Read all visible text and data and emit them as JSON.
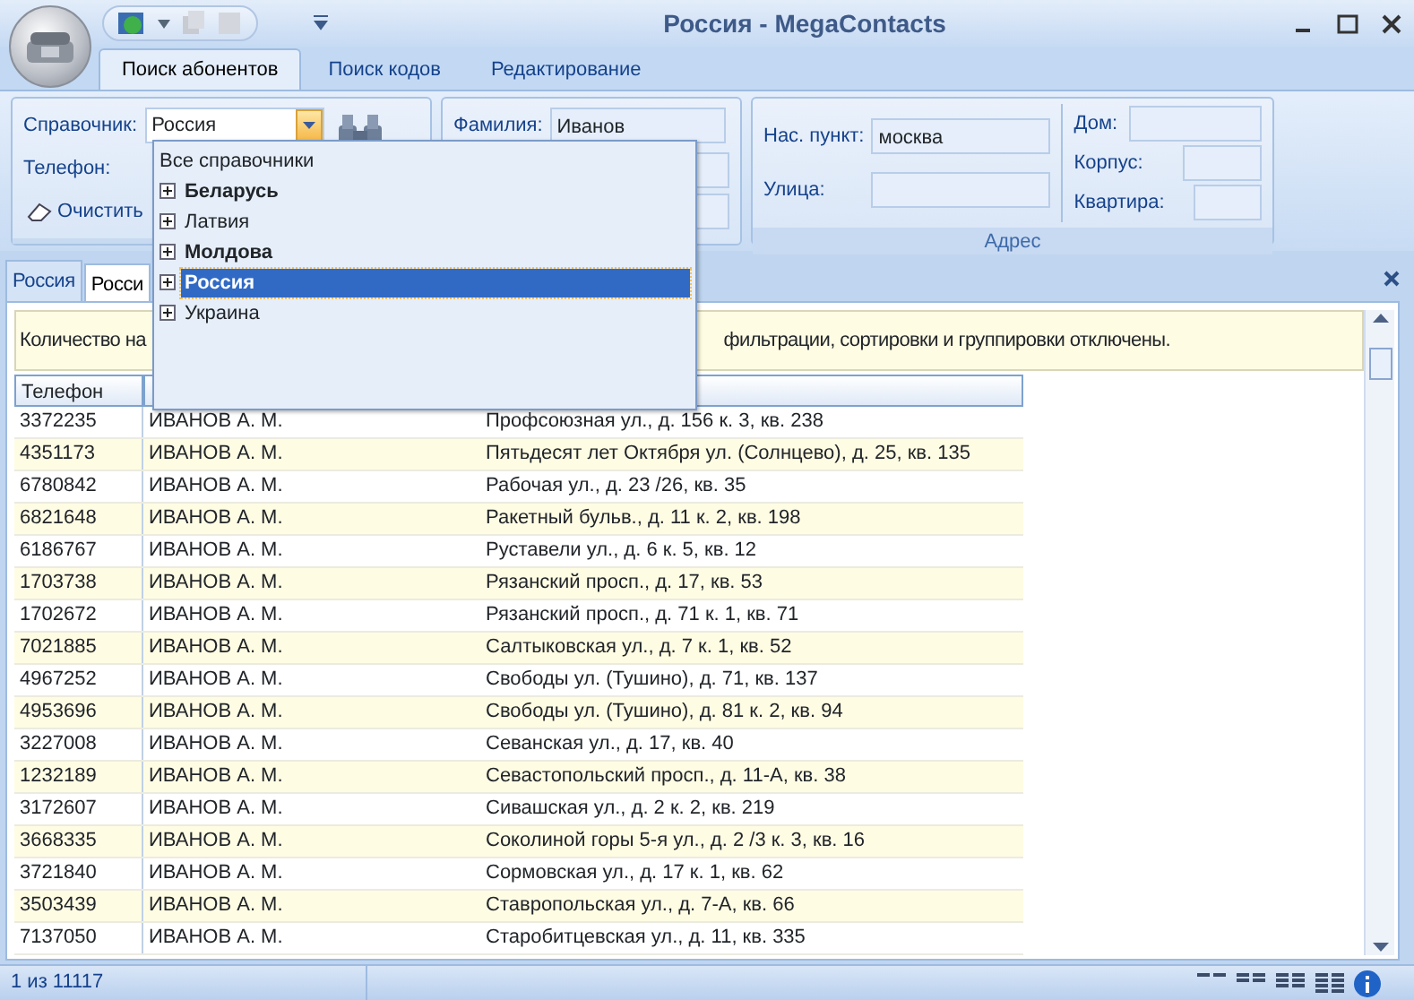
{
  "window": {
    "title": "Россия - MegaContacts"
  },
  "ribbon_tabs": [
    {
      "label": "Поиск абонентов",
      "selected": true
    },
    {
      "label": "Поиск кодов",
      "selected": false
    },
    {
      "label": "Редактирование",
      "selected": false
    }
  ],
  "search_group": {
    "directory_label": "Справочник:",
    "directory_value": "Россия",
    "phone_label": "Телефон:",
    "clear_button": "Очистить"
  },
  "name_group": {
    "surname_label": "Фамилия:",
    "surname_value": "Иванов"
  },
  "address_group": {
    "title": "Адрес",
    "city_label": "Нас. пункт:",
    "city_value": "москва",
    "street_label": "Улица:",
    "house_label": "Дом:",
    "building_label": "Корпус:",
    "apartment_label": "Квартира:"
  },
  "directory_dropdown": [
    {
      "label": "Все справочники",
      "kind": "root",
      "bold": false,
      "selected": false
    },
    {
      "label": "Беларусь",
      "kind": "node",
      "bold": true,
      "selected": false
    },
    {
      "label": "Латвия",
      "kind": "node",
      "bold": false,
      "selected": false
    },
    {
      "label": "Молдова",
      "kind": "node",
      "bold": true,
      "selected": false
    },
    {
      "label": "Россия",
      "kind": "node",
      "bold": true,
      "selected": true
    },
    {
      "label": "Украина",
      "kind": "node",
      "bold": false,
      "selected": false
    }
  ],
  "doc_tabs": [
    {
      "label": "Россия",
      "selected": false
    },
    {
      "label": "Росси",
      "selected": true
    }
  ],
  "info_bar": {
    "text_start": "Количество на",
    "text_end": "фильтрации, сортировки и группировки отключены."
  },
  "table": {
    "columns": [
      "Телефон"
    ],
    "rows": [
      [
        "3372235",
        "ИВАНОВ А. М.",
        "Профсоюзная ул., д. 156 к. 3, кв. 238"
      ],
      [
        "4351173",
        "ИВАНОВ А. М.",
        "Пятьдесят лет Октября ул. (Солнцево), д. 25, кв. 135"
      ],
      [
        "6780842",
        "ИВАНОВ А. М.",
        "Рабочая ул., д. 23 /26, кв. 35"
      ],
      [
        "6821648",
        "ИВАНОВ А. М.",
        "Ракетный бульв., д. 11 к. 2, кв. 198"
      ],
      [
        "6186767",
        "ИВАНОВ А. М.",
        "Руставели ул., д. 6 к. 5, кв. 12"
      ],
      [
        "1703738",
        "ИВАНОВ А. М.",
        "Рязанский просп., д. 17, кв. 53"
      ],
      [
        "1702672",
        "ИВАНОВ А. М.",
        "Рязанский просп., д. 71 к. 1, кв. 71"
      ],
      [
        "7021885",
        "ИВАНОВ А. М.",
        "Салтыковская ул., д. 7 к. 1, кв. 52"
      ],
      [
        "4967252",
        "ИВАНОВ А. М.",
        "Свободы ул. (Тушино), д. 71, кв. 137"
      ],
      [
        "4953696",
        "ИВАНОВ А. М.",
        "Свободы ул. (Тушино), д. 81 к. 2, кв. 94"
      ],
      [
        "3227008",
        "ИВАНОВ А. М.",
        "Севанская ул., д. 17, кв. 40"
      ],
      [
        "1232189",
        "ИВАНОВ А. М.",
        "Севастопольский просп., д. 11-А, кв. 38"
      ],
      [
        "3172607",
        "ИВАНОВ А. М.",
        "Сивашская ул., д. 2 к. 2, кв. 219"
      ],
      [
        "3668335",
        "ИВАНОВ А. М.",
        "Соколиной горы 5-я ул., д. 2 /3 к. 3, кв. 16"
      ],
      [
        "3721840",
        "ИВАНОВ А. М.",
        "Сормовская ул., д. 17 к. 1, кв. 62"
      ],
      [
        "3503439",
        "ИВАНОВ А. М.",
        "Ставропольская ул., д. 7-А, кв. 66"
      ],
      [
        "7137050",
        "ИВАНОВ А. М.",
        "Старобитцевская ул., д. 11, кв. 335"
      ]
    ]
  },
  "status_bar": {
    "record": "1 из 11117"
  }
}
